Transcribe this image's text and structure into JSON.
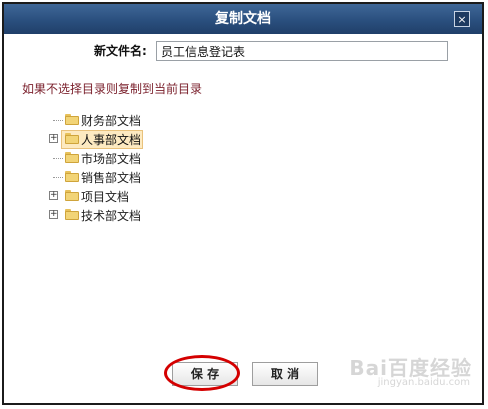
{
  "dialog": {
    "title": "复制文档",
    "close_symbol": "×"
  },
  "form": {
    "name_label": "新文件名:",
    "name_value": "员工信息登记表",
    "hint": "如果不选择目录则复制到当前目录"
  },
  "tree": {
    "nodes": [
      {
        "label": "财务部文档",
        "expandable": false,
        "selected": false
      },
      {
        "label": "人事部文档",
        "expandable": true,
        "selected": true
      },
      {
        "label": "市场部文档",
        "expandable": false,
        "selected": false
      },
      {
        "label": "销售部文档",
        "expandable": false,
        "selected": false
      },
      {
        "label": "项目文档",
        "expandable": true,
        "selected": false
      },
      {
        "label": "技术部文档",
        "expandable": true,
        "selected": false
      }
    ],
    "expand_symbol": "+"
  },
  "buttons": {
    "save_label": "保 存",
    "cancel_label": "取 消"
  },
  "watermark": {
    "brand": "Bai百度经验",
    "url": "jingyan.baidu.com"
  },
  "colors": {
    "titlebar": "#2a4f7e",
    "hint_text": "#7a1f2b",
    "selection": "#fdeac1",
    "annotation_circle": "#d40000"
  }
}
